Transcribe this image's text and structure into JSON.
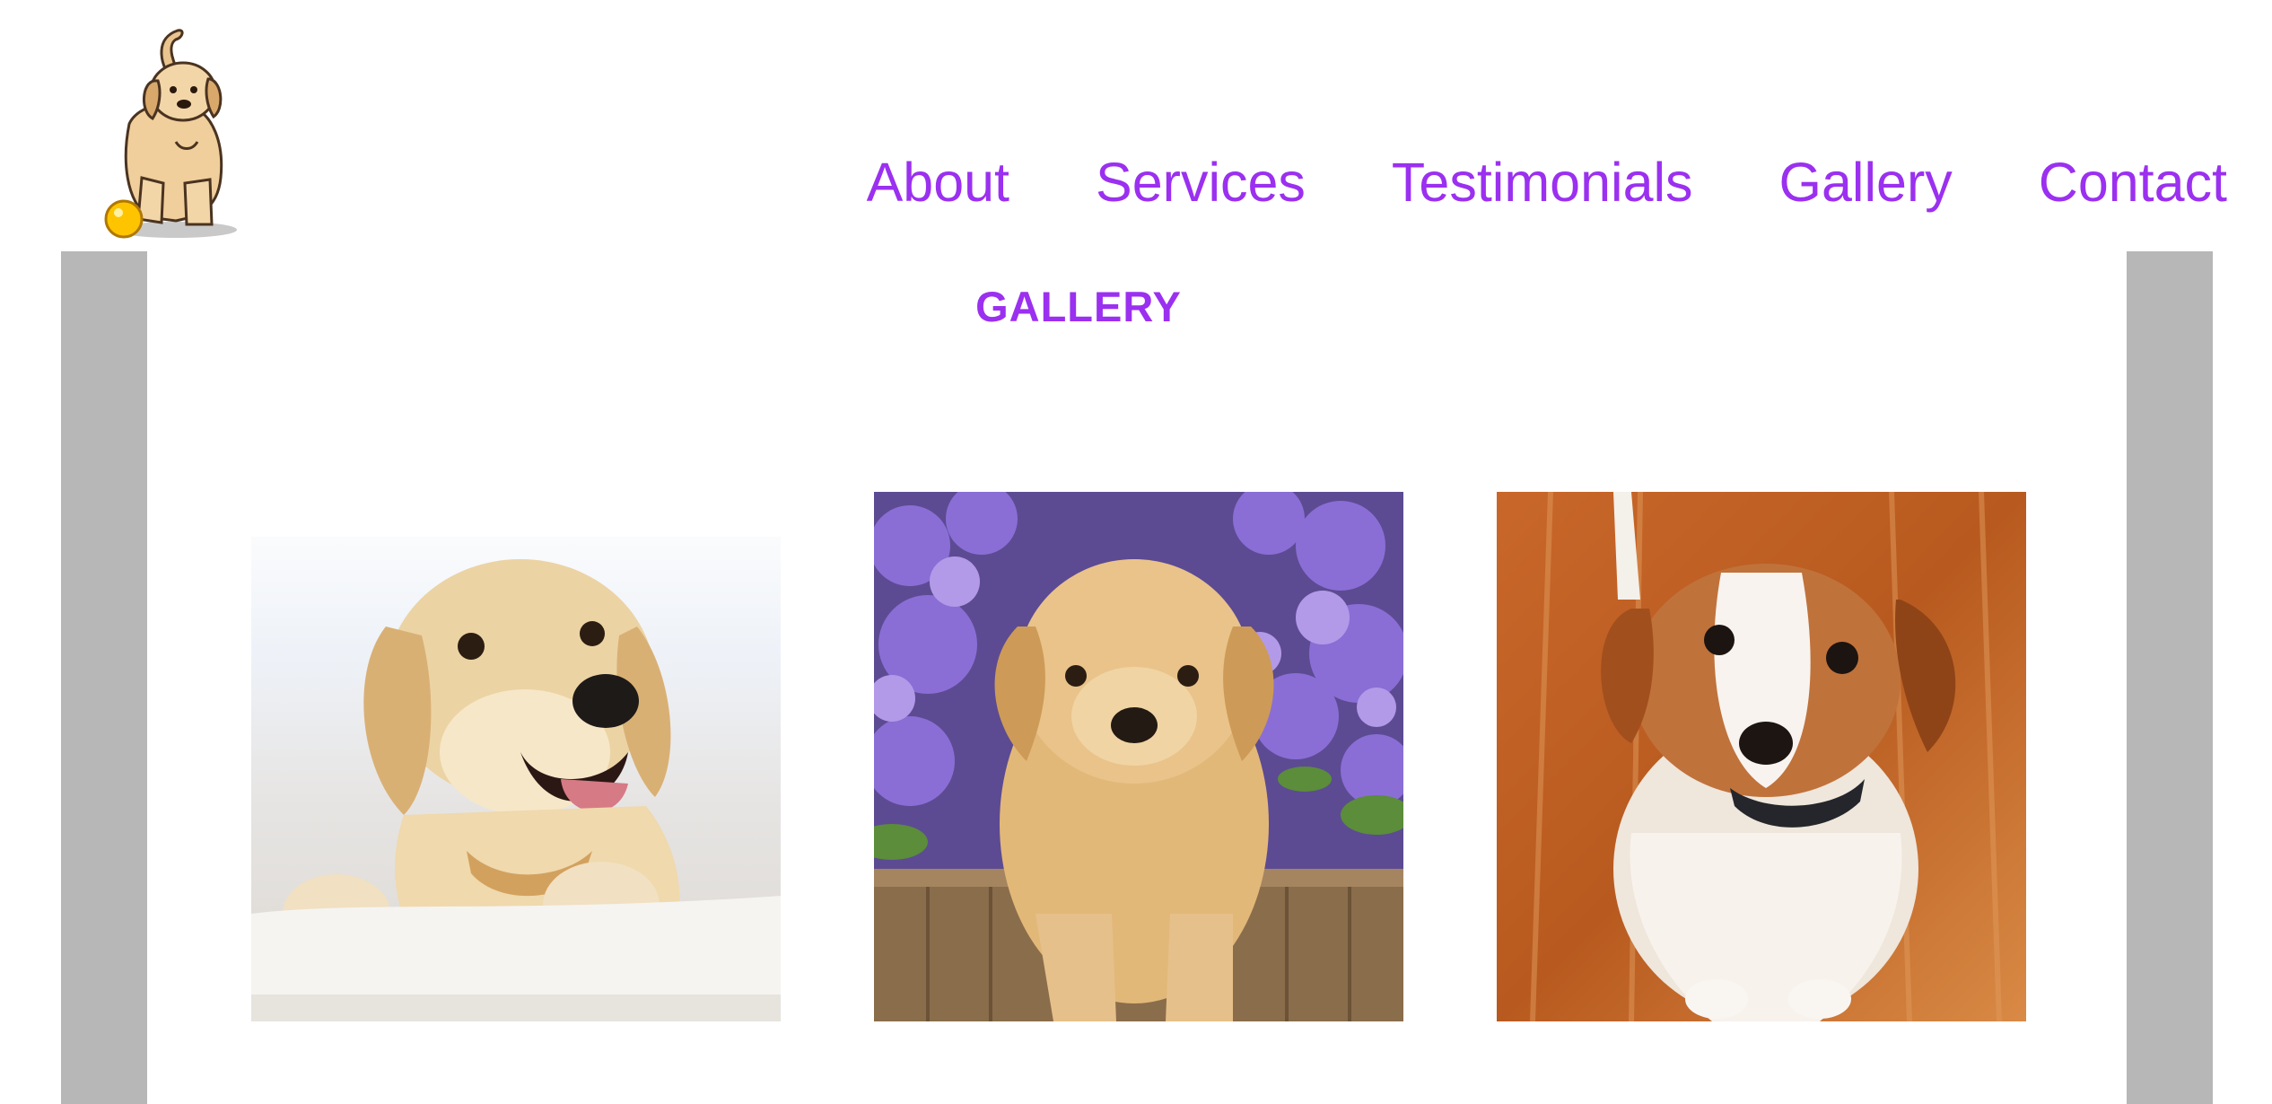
{
  "header": {
    "logo_icon": "puppy-with-ball-icon"
  },
  "nav": {
    "items": [
      {
        "label": "About"
      },
      {
        "label": "Services"
      },
      {
        "label": "Testimonials"
      },
      {
        "label": "Gallery"
      },
      {
        "label": "Contact"
      }
    ]
  },
  "gallery": {
    "title": "GALLERY",
    "photos": [
      {
        "subject": "golden-retriever-puppy-smiling"
      },
      {
        "subject": "golden-retriever-puppy-with-flowers"
      },
      {
        "subject": "beagle-mix-puppy-on-wood-floor"
      }
    ]
  },
  "colors": {
    "accent": "#9b30f0",
    "side_bar": "#b6b7b6",
    "background": "#ffffff"
  }
}
